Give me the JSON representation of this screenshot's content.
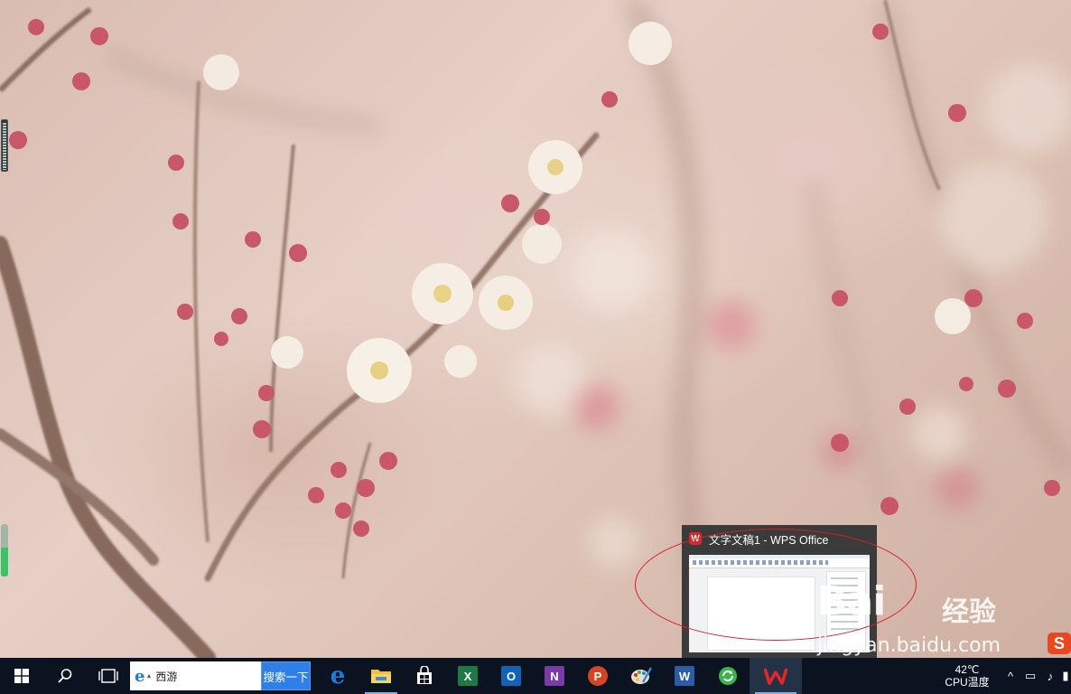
{
  "window_preview": {
    "title": "文字文稿1 - WPS Office",
    "app_icon": "wps-logo-icon"
  },
  "watermark": {
    "brand": "Bai",
    "product": "经验",
    "url": "jingyan.baidu.com",
    "badge": "S"
  },
  "taskbar": {
    "search_value": "西游",
    "search_button_label": "搜索一下",
    "apps": [
      {
        "name": "edge-icon",
        "label": "e",
        "color": "#1e7ad8"
      },
      {
        "name": "file-explorer-icon",
        "label": "",
        "color": "#f2c13b"
      },
      {
        "name": "store-icon",
        "label": "",
        "color": "#ffffff"
      },
      {
        "name": "excel-icon",
        "label": "X",
        "color": "#1d7a44"
      },
      {
        "name": "outlook-icon",
        "label": "O",
        "color": "#0f64b8"
      },
      {
        "name": "onenote-icon",
        "label": "N",
        "color": "#7a3aa8"
      },
      {
        "name": "powerpoint-icon",
        "label": "P",
        "color": "#d24625"
      },
      {
        "name": "paint-icon",
        "label": "",
        "color": "#3e86c9"
      },
      {
        "name": "word-icon",
        "label": "W",
        "color": "#2a5ca8"
      },
      {
        "name": "green-refresh-icon",
        "label": "",
        "color": "#3ab54a"
      },
      {
        "name": "wps-icon",
        "label": "W",
        "color": "#d9282b"
      }
    ],
    "tray": {
      "temperature": "42℃",
      "temperature_label": "CPU温度"
    }
  },
  "colors": {
    "taskbar_bg": "#0b1320",
    "search_button": "#2f7fe8",
    "annotation_red": "#d8202a",
    "preview_bg": "#3b3b3b"
  }
}
